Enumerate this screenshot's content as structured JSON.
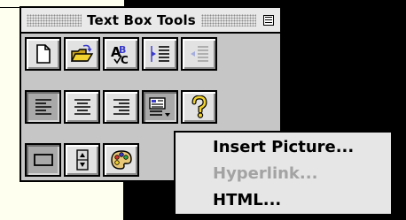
{
  "palette": {
    "title": "Text Box Tools",
    "tools": [
      {
        "icon": "new-document-icon",
        "state": "normal"
      },
      {
        "icon": "open-folder-icon",
        "state": "normal"
      },
      {
        "icon": "spelling-check-icon",
        "state": "normal"
      },
      {
        "icon": "increase-indent-icon",
        "state": "normal"
      },
      {
        "icon": "decrease-indent-icon",
        "state": "disabled"
      },
      {
        "icon": "align-left-icon",
        "state": "pressed"
      },
      {
        "icon": "align-center-icon",
        "state": "normal"
      },
      {
        "icon": "align-right-icon",
        "state": "normal"
      },
      {
        "icon": "insert-object-menu-icon",
        "state": "pressed"
      },
      {
        "icon": "help-icon",
        "state": "normal"
      },
      {
        "icon": "border-rectangle-icon",
        "state": "pressed"
      },
      {
        "icon": "scroll-arrows-icon",
        "state": "normal"
      },
      {
        "icon": "color-palette-icon",
        "state": "normal"
      }
    ]
  },
  "menu": {
    "items": [
      {
        "label": "Insert Picture...",
        "enabled": true
      },
      {
        "label": "Hyperlink...",
        "enabled": false
      },
      {
        "label": "HTML...",
        "enabled": true
      }
    ]
  },
  "colors": {
    "desktop": "#000000",
    "document": "#fffff0",
    "palette_face": "#c6c6c6",
    "button_face": "#e2e2e2",
    "button_pressed": "#a9a9a9",
    "menu_bg": "#e6e6e6",
    "disabled_text": "#a3a3a3",
    "icon_blue": "#3a3acb",
    "folder_yellow": "#f2d230"
  }
}
